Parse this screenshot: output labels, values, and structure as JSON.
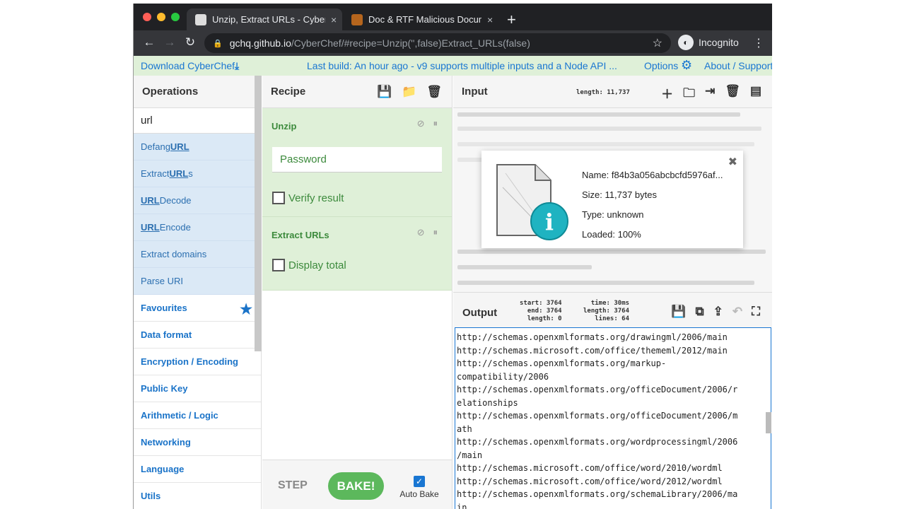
{
  "browser": {
    "tabs": [
      {
        "title": "Unzip, Extract URLs - CyberChef",
        "close": "×"
      },
      {
        "title": "Doc & RTF Malicious Document Cheat Sheet",
        "close": "×"
      }
    ],
    "new_tab": "+",
    "url_host": "gchq.github.io",
    "url_path": "/CyberChef/#recipe=Unzip('',false)Extract_URLs(false)",
    "profile": "Incognito"
  },
  "banner": {
    "download": "Download CyberChef",
    "build": "Last build: An hour ago - v9 supports multiple inputs and a Node API ...",
    "options": "Options",
    "about": "About / Support"
  },
  "operations": {
    "title": "Operations",
    "search_value": "url",
    "results": [
      {
        "pre": "Defang ",
        "hl": "URL",
        "post": ""
      },
      {
        "pre": "Extract ",
        "hl": "URL",
        "post": "s"
      },
      {
        "pre": "",
        "hl": "URL",
        "post": " Decode"
      },
      {
        "pre": "",
        "hl": "URL",
        "post": " Encode"
      },
      {
        "pre": "Extract domains",
        "hl": "",
        "post": ""
      },
      {
        "pre": "Parse URI",
        "hl": "",
        "post": ""
      }
    ],
    "categories": [
      "Favourites",
      "Data format",
      "Encryption / Encoding",
      "Public Key",
      "Arithmetic / Logic",
      "Networking",
      "Language",
      "Utils"
    ]
  },
  "recipe": {
    "title": "Recipe",
    "ops": [
      {
        "name": "Unzip",
        "password_placeholder": "Password",
        "checkbox": "Verify result"
      },
      {
        "name": "Extract URLs",
        "checkbox": "Display total"
      }
    ],
    "step_label": "STEP",
    "bake_label": "BAKE!",
    "autobake_label": "Auto Bake",
    "autobake_checked": true
  },
  "input": {
    "title": "Input",
    "length_label": "length: 11,737",
    "file": {
      "name": "Name: f84b3a056abcbcfd5976af...",
      "size": "Size: 11,737 bytes",
      "type": "Type: unknown",
      "loaded": "Loaded: 100%"
    }
  },
  "output": {
    "title": "Output",
    "stats_left": [
      "start: 3764",
      "end: 3764",
      "length:    0"
    ],
    "stats_right": [
      "time: 30ms",
      "length: 3764",
      "lines:   64"
    ],
    "lines": [
      "http://schemas.openxmlformats.org/drawingml/2006/main",
      "http://schemas.microsoft.com/office/thememl/2012/main",
      "http://schemas.openxmlformats.org/markup-",
      "compatibility/2006",
      "http://schemas.openxmlformats.org/officeDocument/2006/r",
      "elationships",
      "http://schemas.openxmlformats.org/officeDocument/2006/m",
      "ath",
      "http://schemas.openxmlformats.org/wordprocessingml/2006",
      "/main",
      "http://schemas.microsoft.com/office/word/2010/wordml",
      "http://schemas.microsoft.com/office/word/2012/wordml",
      "http://schemas.openxmlformats.org/schemaLibrary/2006/ma",
      "in"
    ]
  }
}
